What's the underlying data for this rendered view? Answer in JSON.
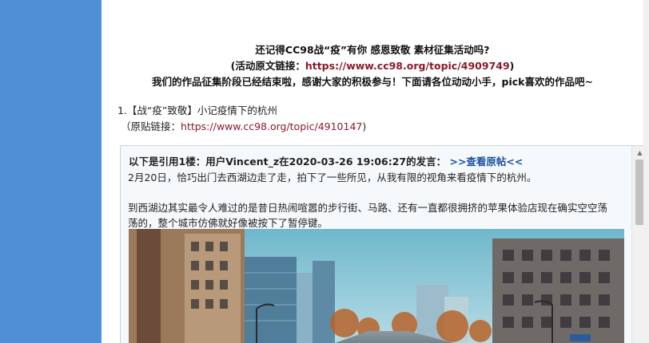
{
  "announcement": {
    "line1": "还记得CC98战“疫”有你 感恩致敬 素材征集活动吗?",
    "line2_prefix": "(活动原文链接：",
    "line2_link": "https://www.cc98.org/topic/4909749",
    "line2_suffix": ")",
    "line3": "我们的作品征集阶段已经结束啦，感谢大家的积极参与！下面请各位动动小手，pick喜欢的作品吧~"
  },
  "entry": {
    "title": "1.【战“疫”致敬】小记疫情下的杭州",
    "link_prefix": "（原贴链接：",
    "link": "https://www.cc98.org/topic/4910147",
    "link_suffix": ")"
  },
  "quote": {
    "header": "以下是引用1楼：用户Vincent_z在2020-03-26 19:06:27的发言：",
    "view_original": ">>查看原帖<<",
    "para1": "2月20日，恰巧出门去西湖边走了走，拍下了一些所见，从我有限的视角来看疫情下的杭州。",
    "para2_line1": "到西湖边其实最令人难过的是昔日热闹喧嚣的步行街、马路、还有一直都很拥挤的苹果体验店现在确实空空荡",
    "para2_line2": "荡的，整个城市仿佛就好像被按下了暂停键。"
  },
  "colors": {
    "sidebar": "#4f8fd6",
    "link_red": "#8a1a2a",
    "link_blue": "#1c4fa0"
  }
}
